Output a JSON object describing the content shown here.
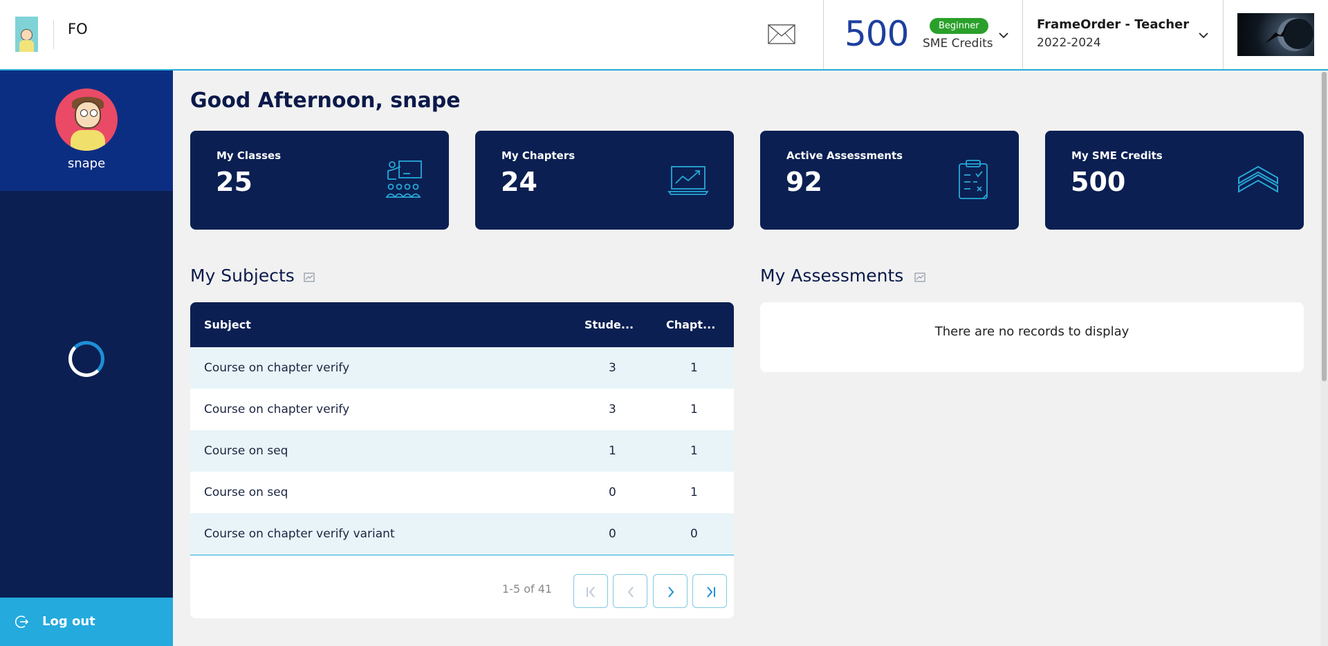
{
  "header": {
    "brand": "FO",
    "credits": "500",
    "level_badge": "Beginner",
    "credits_label": "SME Credits",
    "org_title": "FrameOrder - Teacher",
    "org_year": "2022-2024",
    "mail_icon": "envelope-icon",
    "dropdown_icon": "chevron-down-icon"
  },
  "sidebar": {
    "username": "snape",
    "logout_label": "Log out",
    "logout_icon": "logout-icon",
    "loading_icon": "spinner-icon"
  },
  "main": {
    "greeting": "Good Afternoon, snape",
    "stats": [
      {
        "title": "My Classes",
        "value": "25",
        "icon": "classroom-icon"
      },
      {
        "title": "My Chapters",
        "value": "24",
        "icon": "laptop-chart-icon"
      },
      {
        "title": "Active Assessments",
        "value": "92",
        "icon": "clipboard-icon"
      },
      {
        "title": "My SME Credits",
        "value": "500",
        "icon": "chevron-rank-icon"
      }
    ],
    "subjects": {
      "title": "My Subjects",
      "columns": [
        "Subject",
        "Stude...",
        "Chapt..."
      ],
      "rows": [
        {
          "subject": "Course on chapter verify",
          "students": "3",
          "chapters": "1"
        },
        {
          "subject": "Course on chapter verify",
          "students": "3",
          "chapters": "1"
        },
        {
          "subject": "Course on seq",
          "students": "1",
          "chapters": "1"
        },
        {
          "subject": "Course on seq",
          "students": "0",
          "chapters": "1"
        },
        {
          "subject": "Course on chapter verify variant",
          "students": "0",
          "chapters": "0"
        }
      ],
      "pager_label": "1-5 of 41"
    },
    "assessments": {
      "title": "My Assessments",
      "empty_text": "There are no records to display"
    }
  },
  "colors": {
    "navy": "#0b1f52",
    "sidebar_profile": "#0c2e82",
    "accent": "#24aadd",
    "credits_number": "#1e3f9e",
    "badge_green": "#2aa02a",
    "row_alt": "#e8f4f8"
  }
}
